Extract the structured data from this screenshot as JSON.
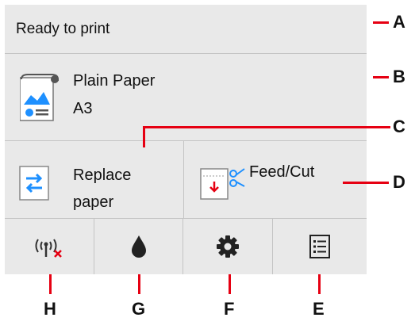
{
  "status": {
    "text": "Ready to print"
  },
  "media": {
    "type": "Plain Paper",
    "size": "A3",
    "icon": "paper-roll-icon"
  },
  "actions": {
    "replace_label": "Replace paper",
    "feed_label": "Feed/Cut"
  },
  "bottom_bar": [
    {
      "icon": "wireless-off-icon"
    },
    {
      "icon": "ink-drop-icon"
    },
    {
      "icon": "gear-icon"
    },
    {
      "icon": "list-icon"
    }
  ],
  "callouts": {
    "a": "A",
    "b": "B",
    "c": "C",
    "d": "D",
    "e": "E",
    "f": "F",
    "g": "G",
    "h": "H"
  },
  "colors": {
    "panel": "#e9e9e9",
    "accent_blue": "#1e90ff",
    "callout_red": "#e60012"
  }
}
